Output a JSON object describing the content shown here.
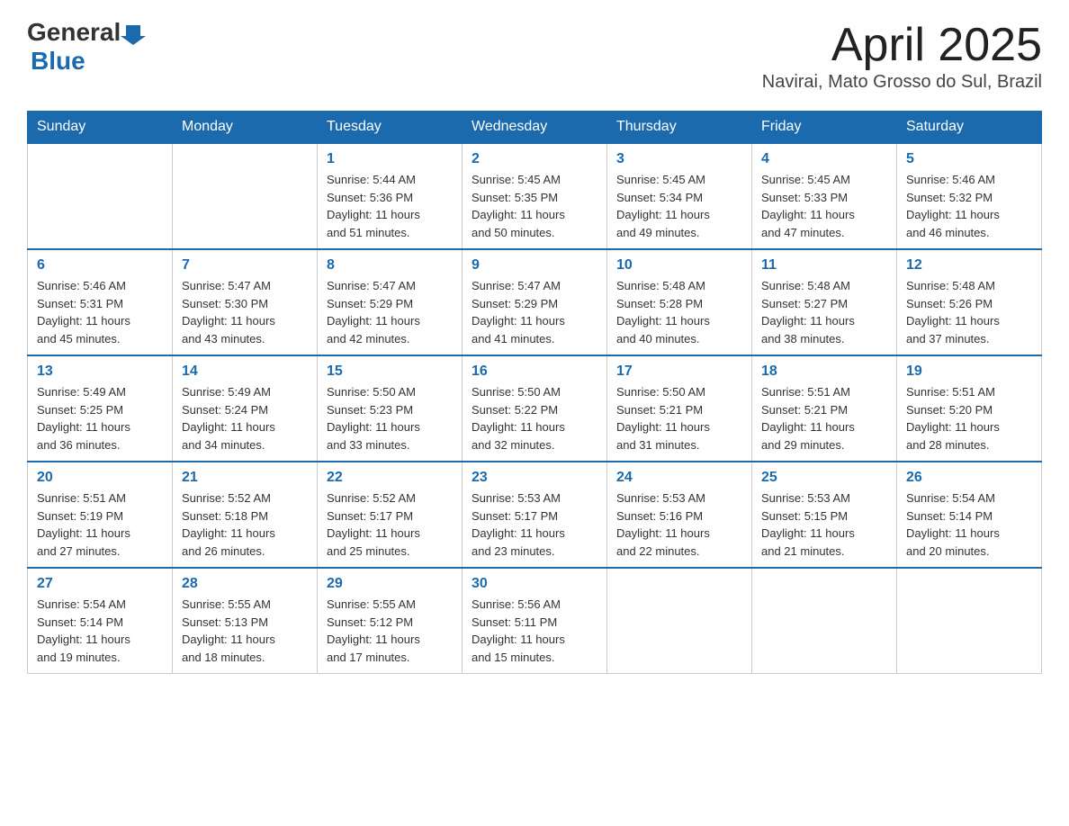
{
  "logo": {
    "general": "General",
    "blue": "Blue"
  },
  "title": "April 2025",
  "location": "Navirai, Mato Grosso do Sul, Brazil",
  "weekdays": [
    "Sunday",
    "Monday",
    "Tuesday",
    "Wednesday",
    "Thursday",
    "Friday",
    "Saturday"
  ],
  "weeks": [
    [
      {
        "day": "",
        "info": ""
      },
      {
        "day": "",
        "info": ""
      },
      {
        "day": "1",
        "info": "Sunrise: 5:44 AM\nSunset: 5:36 PM\nDaylight: 11 hours\nand 51 minutes."
      },
      {
        "day": "2",
        "info": "Sunrise: 5:45 AM\nSunset: 5:35 PM\nDaylight: 11 hours\nand 50 minutes."
      },
      {
        "day": "3",
        "info": "Sunrise: 5:45 AM\nSunset: 5:34 PM\nDaylight: 11 hours\nand 49 minutes."
      },
      {
        "day": "4",
        "info": "Sunrise: 5:45 AM\nSunset: 5:33 PM\nDaylight: 11 hours\nand 47 minutes."
      },
      {
        "day": "5",
        "info": "Sunrise: 5:46 AM\nSunset: 5:32 PM\nDaylight: 11 hours\nand 46 minutes."
      }
    ],
    [
      {
        "day": "6",
        "info": "Sunrise: 5:46 AM\nSunset: 5:31 PM\nDaylight: 11 hours\nand 45 minutes."
      },
      {
        "day": "7",
        "info": "Sunrise: 5:47 AM\nSunset: 5:30 PM\nDaylight: 11 hours\nand 43 minutes."
      },
      {
        "day": "8",
        "info": "Sunrise: 5:47 AM\nSunset: 5:29 PM\nDaylight: 11 hours\nand 42 minutes."
      },
      {
        "day": "9",
        "info": "Sunrise: 5:47 AM\nSunset: 5:29 PM\nDaylight: 11 hours\nand 41 minutes."
      },
      {
        "day": "10",
        "info": "Sunrise: 5:48 AM\nSunset: 5:28 PM\nDaylight: 11 hours\nand 40 minutes."
      },
      {
        "day": "11",
        "info": "Sunrise: 5:48 AM\nSunset: 5:27 PM\nDaylight: 11 hours\nand 38 minutes."
      },
      {
        "day": "12",
        "info": "Sunrise: 5:48 AM\nSunset: 5:26 PM\nDaylight: 11 hours\nand 37 minutes."
      }
    ],
    [
      {
        "day": "13",
        "info": "Sunrise: 5:49 AM\nSunset: 5:25 PM\nDaylight: 11 hours\nand 36 minutes."
      },
      {
        "day": "14",
        "info": "Sunrise: 5:49 AM\nSunset: 5:24 PM\nDaylight: 11 hours\nand 34 minutes."
      },
      {
        "day": "15",
        "info": "Sunrise: 5:50 AM\nSunset: 5:23 PM\nDaylight: 11 hours\nand 33 minutes."
      },
      {
        "day": "16",
        "info": "Sunrise: 5:50 AM\nSunset: 5:22 PM\nDaylight: 11 hours\nand 32 minutes."
      },
      {
        "day": "17",
        "info": "Sunrise: 5:50 AM\nSunset: 5:21 PM\nDaylight: 11 hours\nand 31 minutes."
      },
      {
        "day": "18",
        "info": "Sunrise: 5:51 AM\nSunset: 5:21 PM\nDaylight: 11 hours\nand 29 minutes."
      },
      {
        "day": "19",
        "info": "Sunrise: 5:51 AM\nSunset: 5:20 PM\nDaylight: 11 hours\nand 28 minutes."
      }
    ],
    [
      {
        "day": "20",
        "info": "Sunrise: 5:51 AM\nSunset: 5:19 PM\nDaylight: 11 hours\nand 27 minutes."
      },
      {
        "day": "21",
        "info": "Sunrise: 5:52 AM\nSunset: 5:18 PM\nDaylight: 11 hours\nand 26 minutes."
      },
      {
        "day": "22",
        "info": "Sunrise: 5:52 AM\nSunset: 5:17 PM\nDaylight: 11 hours\nand 25 minutes."
      },
      {
        "day": "23",
        "info": "Sunrise: 5:53 AM\nSunset: 5:17 PM\nDaylight: 11 hours\nand 23 minutes."
      },
      {
        "day": "24",
        "info": "Sunrise: 5:53 AM\nSunset: 5:16 PM\nDaylight: 11 hours\nand 22 minutes."
      },
      {
        "day": "25",
        "info": "Sunrise: 5:53 AM\nSunset: 5:15 PM\nDaylight: 11 hours\nand 21 minutes."
      },
      {
        "day": "26",
        "info": "Sunrise: 5:54 AM\nSunset: 5:14 PM\nDaylight: 11 hours\nand 20 minutes."
      }
    ],
    [
      {
        "day": "27",
        "info": "Sunrise: 5:54 AM\nSunset: 5:14 PM\nDaylight: 11 hours\nand 19 minutes."
      },
      {
        "day": "28",
        "info": "Sunrise: 5:55 AM\nSunset: 5:13 PM\nDaylight: 11 hours\nand 18 minutes."
      },
      {
        "day": "29",
        "info": "Sunrise: 5:55 AM\nSunset: 5:12 PM\nDaylight: 11 hours\nand 17 minutes."
      },
      {
        "day": "30",
        "info": "Sunrise: 5:56 AM\nSunset: 5:11 PM\nDaylight: 11 hours\nand 15 minutes."
      },
      {
        "day": "",
        "info": ""
      },
      {
        "day": "",
        "info": ""
      },
      {
        "day": "",
        "info": ""
      }
    ]
  ]
}
